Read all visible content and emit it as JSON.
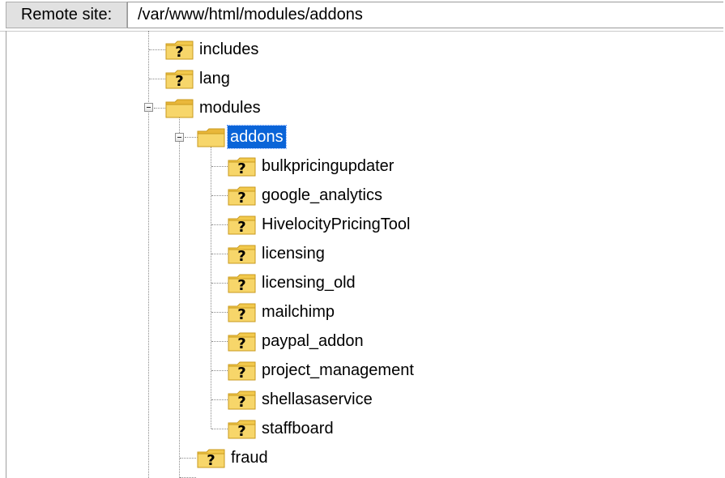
{
  "address_bar": {
    "label": "Remote site:",
    "path": "/var/www/html/modules/addons"
  },
  "tree": {
    "level1": [
      {
        "label": "includes",
        "icon": "unknown-folder-icon"
      },
      {
        "label": "lang",
        "icon": "unknown-folder-icon"
      }
    ],
    "modules": {
      "label": "modules",
      "icon": "folder-icon",
      "expanded": true
    },
    "addons": {
      "label": "addons",
      "icon": "folder-icon",
      "expanded": true,
      "selected": true
    },
    "addon_children": [
      {
        "label": "bulkpricingupdater",
        "icon": "unknown-folder-icon"
      },
      {
        "label": "google_analytics",
        "icon": "unknown-folder-icon"
      },
      {
        "label": "HivelocityPricingTool",
        "icon": "unknown-folder-icon"
      },
      {
        "label": "licensing",
        "icon": "unknown-folder-icon"
      },
      {
        "label": "licensing_old",
        "icon": "unknown-folder-icon"
      },
      {
        "label": "mailchimp",
        "icon": "unknown-folder-icon"
      },
      {
        "label": "paypal_addon",
        "icon": "unknown-folder-icon"
      },
      {
        "label": "project_management",
        "icon": "unknown-folder-icon"
      },
      {
        "label": "shellasaservice",
        "icon": "unknown-folder-icon"
      },
      {
        "label": "staffboard",
        "icon": "unknown-folder-icon"
      }
    ],
    "modules_children_after": [
      {
        "label": "fraud",
        "icon": "unknown-folder-icon"
      }
    ]
  }
}
